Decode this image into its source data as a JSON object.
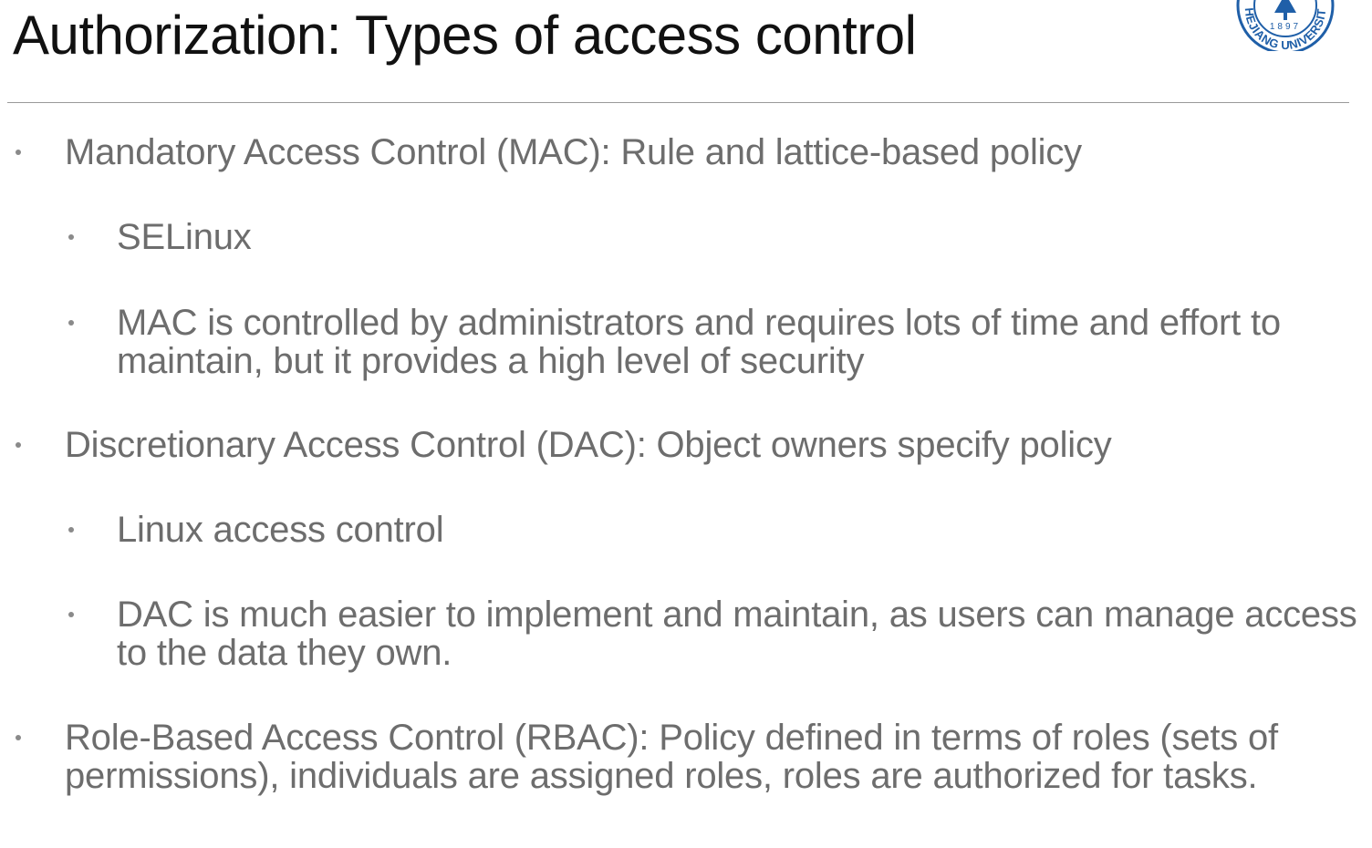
{
  "slide": {
    "title": "Authorization: Types of access control",
    "logo": {
      "year": "1897",
      "text": "ZHEJIANG UNIVERSITY",
      "color": "#1f5fa8"
    }
  },
  "bullets": [
    {
      "level": 1,
      "text": "Mandatory Access Control (MAC): Rule and lattice-based policy"
    },
    {
      "level": 2,
      "text": "SELinux"
    },
    {
      "level": 2,
      "text": "MAC is controlled by administrators and requires lots of time and effort to maintain, but it provides a high level of security"
    },
    {
      "level": 1,
      "text": "Discretionary Access Control (DAC): Object owners specify policy"
    },
    {
      "level": 2,
      "text": "Linux access control"
    },
    {
      "level": 2,
      "text": "DAC is much easier to implement and maintain, as users can manage access to the data they own."
    },
    {
      "level": 1,
      "text": "Role-Based Access Control (RBAC): Policy defined in terms of roles (sets of permissions), individuals are assigned roles, roles are authorized for tasks."
    }
  ]
}
